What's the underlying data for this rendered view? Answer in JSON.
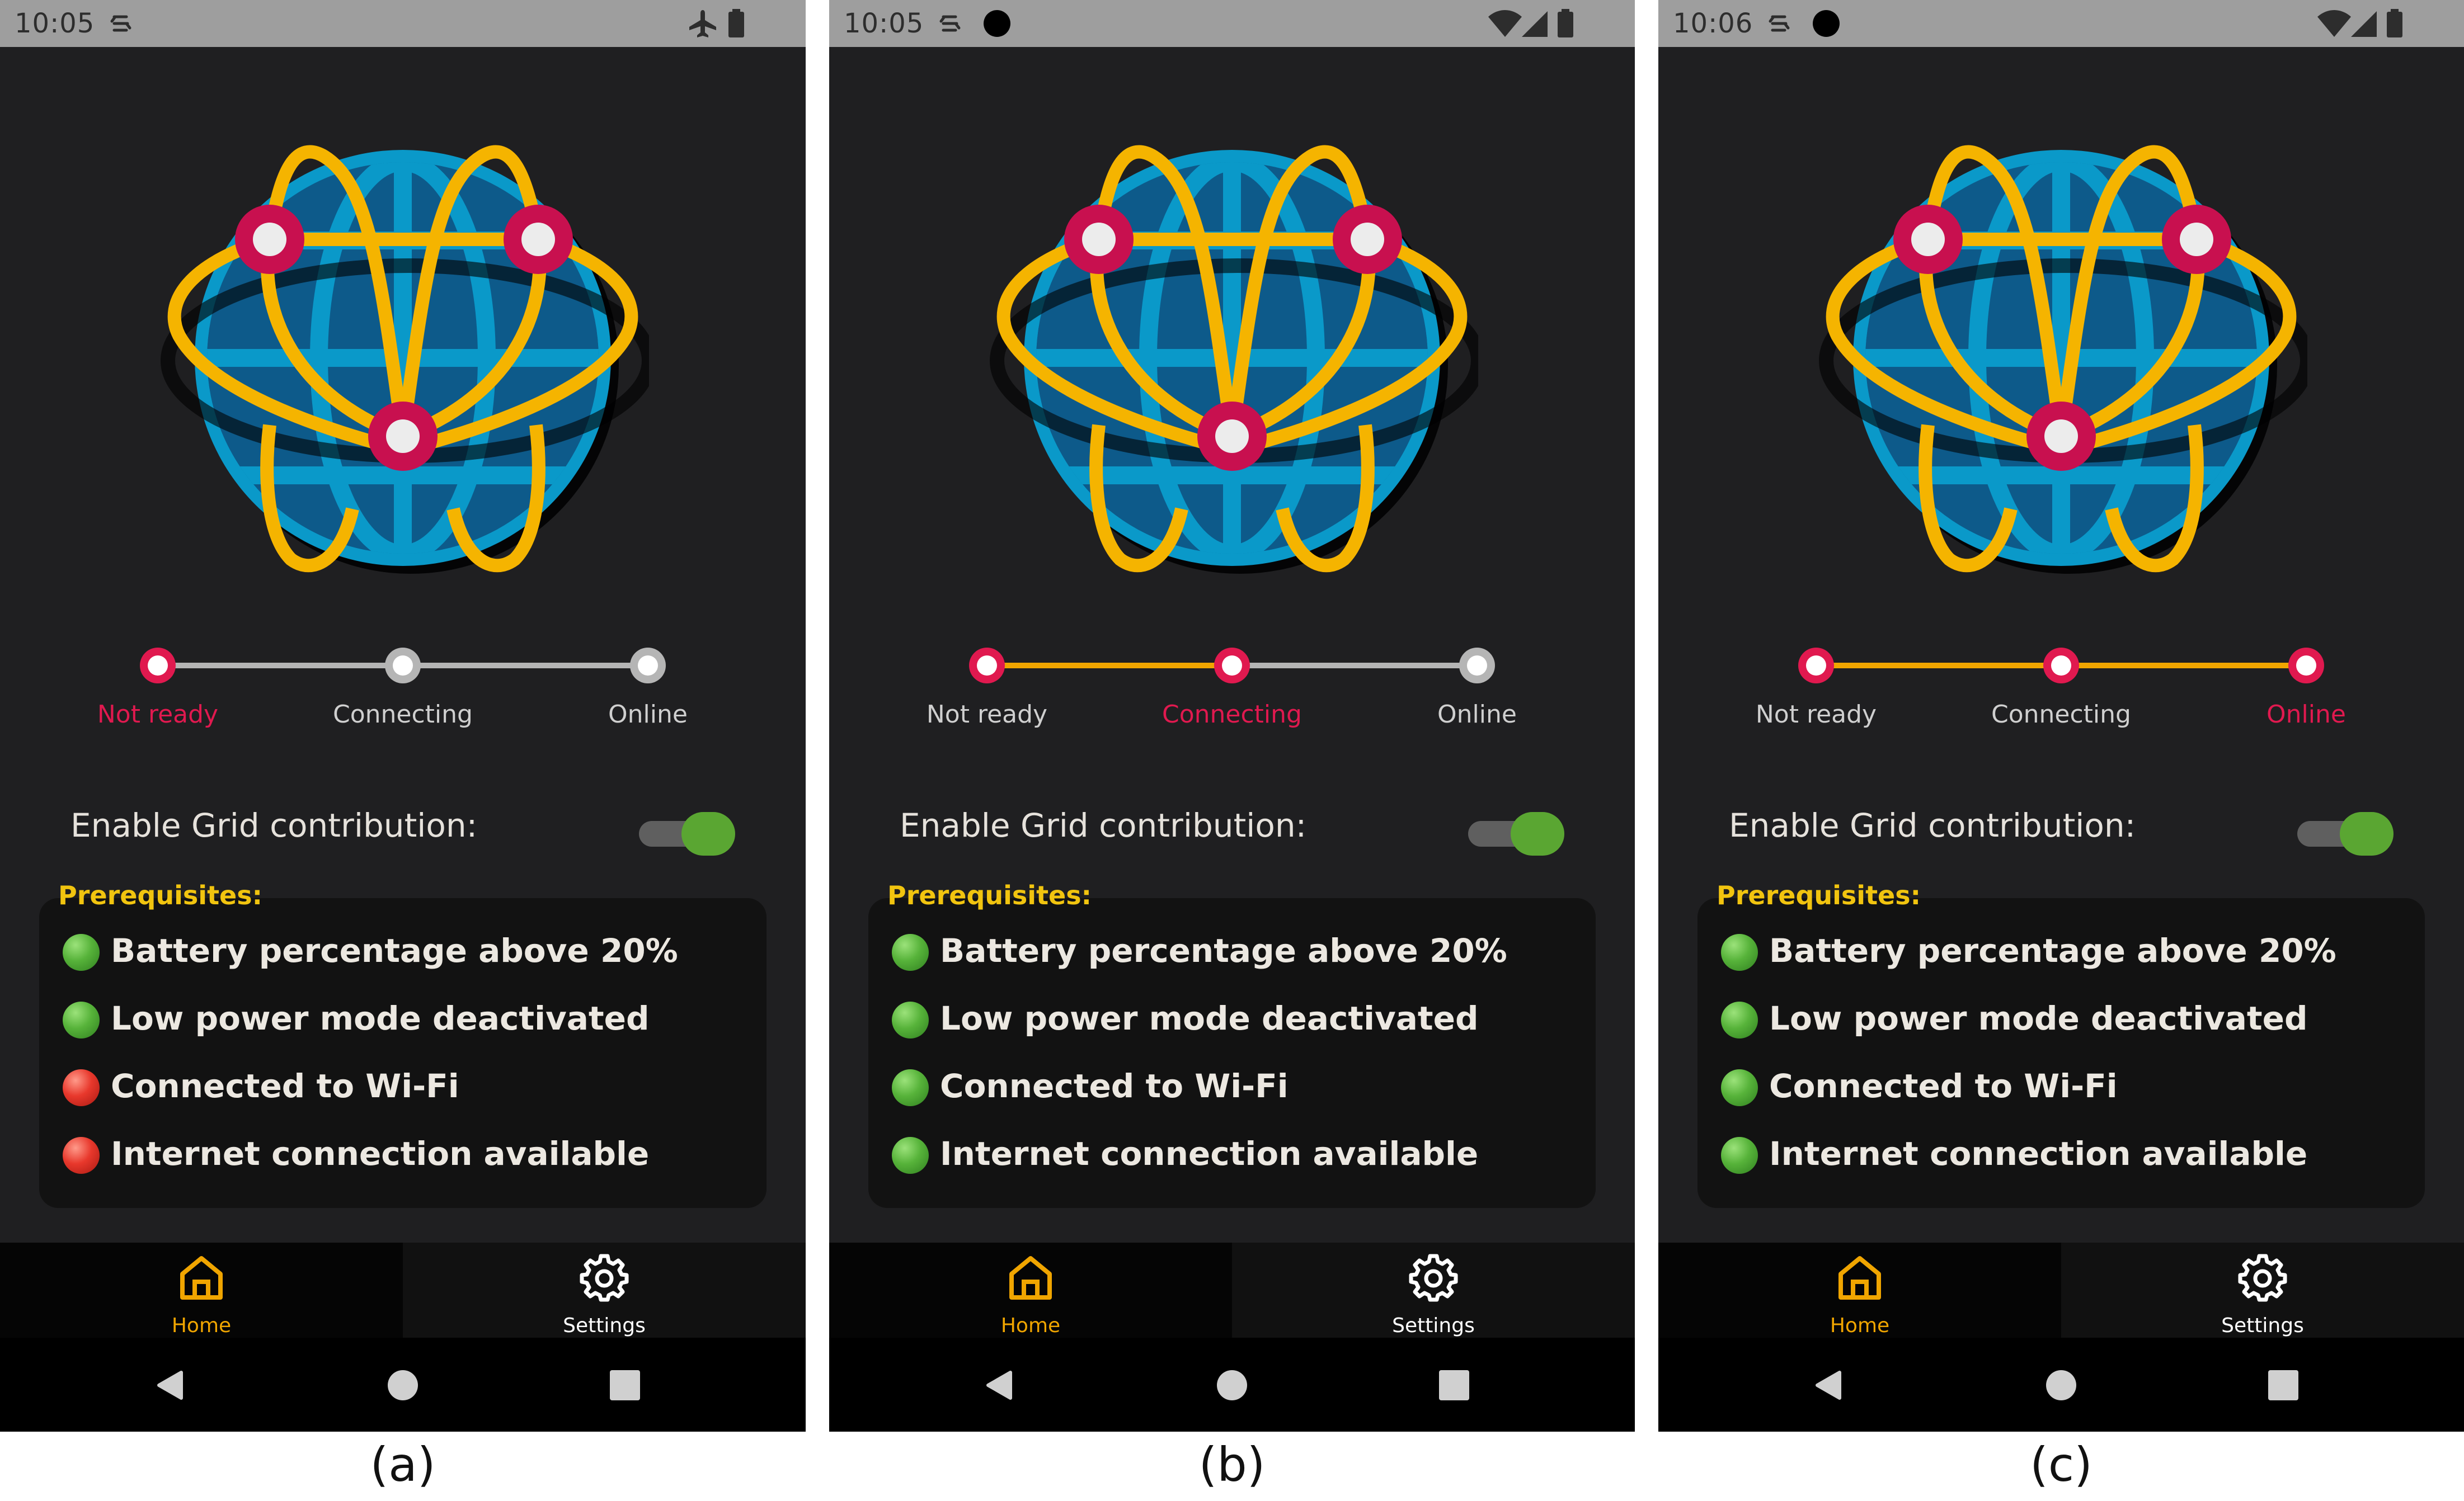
{
  "screens": [
    {
      "caption": "(a)",
      "status_time": "10:05",
      "status_icons": [
        "sync-icon",
        "airplane-icon",
        "battery-icon"
      ],
      "stepper": {
        "labels": [
          "Not ready",
          "Connecting",
          "Online"
        ],
        "active_step": 0
      },
      "enable_label": "Enable Grid contribution:",
      "toggle_on": true,
      "prereq_title": "Prerequisites:",
      "prereqs": [
        {
          "text": "Battery percentage above 20%",
          "status": "ok"
        },
        {
          "text": "Low power mode deactivated",
          "status": "ok"
        },
        {
          "text": "Connected to Wi-Fi",
          "status": "fail"
        },
        {
          "text": "Internet connection available",
          "status": "fail"
        }
      ],
      "nav": {
        "home": "Home",
        "settings": "Settings"
      }
    },
    {
      "caption": "(b)",
      "status_time": "10:05",
      "status_icons": [
        "sync-icon",
        "record-icon",
        "wifi-icon",
        "signal-icon",
        "battery-icon"
      ],
      "stepper": {
        "labels": [
          "Not ready",
          "Connecting",
          "Online"
        ],
        "active_step": 1
      },
      "enable_label": "Enable Grid contribution:",
      "toggle_on": true,
      "prereq_title": "Prerequisites:",
      "prereqs": [
        {
          "text": "Battery percentage above 20%",
          "status": "ok"
        },
        {
          "text": "Low power mode deactivated",
          "status": "ok"
        },
        {
          "text": "Connected to Wi-Fi",
          "status": "ok"
        },
        {
          "text": "Internet connection available",
          "status": "ok"
        }
      ],
      "nav": {
        "home": "Home",
        "settings": "Settings"
      }
    },
    {
      "caption": "(c)",
      "status_time": "10:06",
      "status_icons": [
        "sync-icon",
        "record-icon",
        "wifi-icon",
        "signal-icon",
        "battery-icon"
      ],
      "stepper": {
        "labels": [
          "Not ready",
          "Connecting",
          "Online"
        ],
        "active_step": 2
      },
      "enable_label": "Enable Grid contribution:",
      "toggle_on": true,
      "prereq_title": "Prerequisites:",
      "prereqs": [
        {
          "text": "Battery percentage above 20%",
          "status": "ok"
        },
        {
          "text": "Low power mode deactivated",
          "status": "ok"
        },
        {
          "text": "Connected to Wi-Fi",
          "status": "ok"
        },
        {
          "text": "Internet connection available",
          "status": "ok"
        }
      ],
      "nav": {
        "home": "Home",
        "settings": "Settings"
      }
    }
  ],
  "colors": {
    "accent_yellow": "#f0a500",
    "accent_red": "#e0194f",
    "ok_green": "#57b33a",
    "fail_red": "#e8382c",
    "globe_blue": "#0a99c9",
    "globe_dark": "#0d5a8a"
  }
}
